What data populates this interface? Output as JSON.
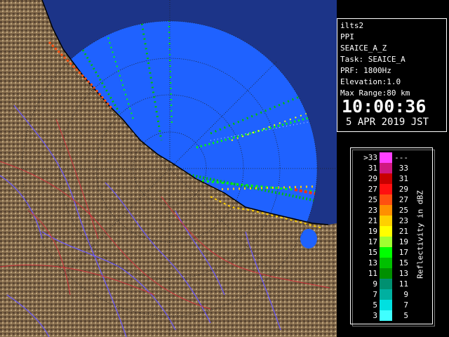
{
  "radar": {
    "name": "ilts2",
    "mode": "PPI",
    "product": "SEAICE_A_Z",
    "task_line": "Task: SEAICE_A",
    "prf_line": "PRF: 1800Hz",
    "elevation_line": "Elevation:1.0",
    "range_line": "Max Range:80 km",
    "time": "10:00:36",
    "date": "5 APR 2019 JST"
  },
  "colors": {
    "sea": "#1f62ff",
    "out_of_range": "#1c3488",
    "land": "#8a7050",
    "rivers": "#6a58ff",
    "roads": "#d0303a",
    "range_rings": "#202020"
  },
  "legend": {
    "title": "Reflectivity in dBZ",
    "rows": [
      {
        "left": ">33",
        "right": "---",
        "color": "#ff40ff"
      },
      {
        "left": "31",
        "right": "33",
        "color": "#d01880"
      },
      {
        "left": "29",
        "right": "31",
        "color": "#c80000"
      },
      {
        "left": "27",
        "right": "29",
        "color": "#ff1010"
      },
      {
        "left": "25",
        "right": "27",
        "color": "#ff5010"
      },
      {
        "left": "23",
        "right": "25",
        "color": "#ff9000"
      },
      {
        "left": "21",
        "right": "23",
        "color": "#ffd000"
      },
      {
        "left": "19",
        "right": "21",
        "color": "#ffff00"
      },
      {
        "left": "17",
        "right": "19",
        "color": "#a0ff30"
      },
      {
        "left": "15",
        "right": "17",
        "color": "#00ff00"
      },
      {
        "left": "13",
        "right": "15",
        "color": "#00c000"
      },
      {
        "left": "11",
        "right": "13",
        "color": "#009000"
      },
      {
        "left": "9",
        "right": "11",
        "color": "#009070"
      },
      {
        "left": "7",
        "right": "9",
        "color": "#00b0a0"
      },
      {
        "left": "5",
        "right": "7",
        "color": "#00e0e0"
      },
      {
        "left": "3",
        "right": "5",
        "color": "#40ffff"
      }
    ]
  }
}
